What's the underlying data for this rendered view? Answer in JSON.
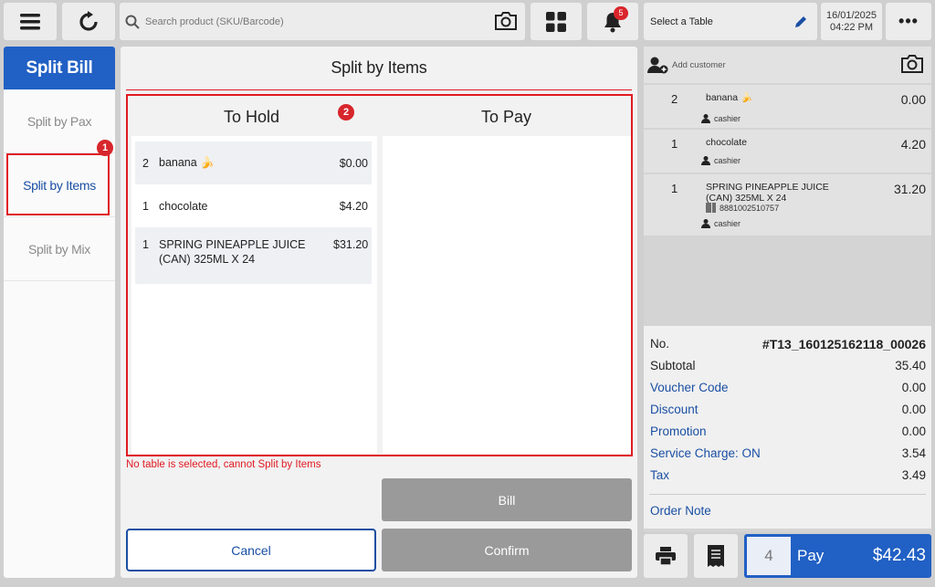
{
  "topbar": {
    "search_placeholder": "Search product (SKU/Barcode)",
    "notifications_count": "5",
    "table_label": "Select a Table",
    "date": "16/01/2025",
    "time": "04:22 PM",
    "more_label": "•••"
  },
  "sidebar": {
    "title": "Split Bill",
    "items": [
      {
        "label": "Split by Pax"
      },
      {
        "label": "Split by Items"
      },
      {
        "label": "Split by Mix"
      }
    ],
    "marker": "1"
  },
  "main": {
    "title": "Split by Items",
    "marker": "2",
    "to_hold_header": "To Hold",
    "to_pay_header": "To Pay",
    "to_hold_items": [
      {
        "qty": "2",
        "name": "banana 🍌",
        "price": "$0.00"
      },
      {
        "qty": "1",
        "name": "chocolate",
        "price": "$4.20"
      },
      {
        "qty": "1",
        "name": "SPRING PINEAPPLE JUICE (CAN) 325ML X 24",
        "price": "$31.20"
      }
    ],
    "error_message": "No table is selected, cannot Split by Items",
    "bill_label": "Bill",
    "cancel_label": "Cancel",
    "confirm_label": "Confirm"
  },
  "cart": {
    "add_customer_label": "Add customer",
    "items": [
      {
        "qty": "2",
        "name": "banana 🍌",
        "price": "0.00",
        "staff": "cashier"
      },
      {
        "qty": "1",
        "name": "chocolate",
        "price": "4.20",
        "staff": "cashier"
      },
      {
        "qty": "1",
        "name": "SPRING PINEAPPLE JUICE (CAN) 325ML X 24",
        "price": "31.20",
        "sku": "8881002510757",
        "staff": "cashier"
      }
    ]
  },
  "summary": {
    "no_label": "No.",
    "no_value": "#T13_160125162118_00026",
    "subtotal_label": "Subtotal",
    "subtotal_value": "35.40",
    "voucher_label": "Voucher Code",
    "voucher_value": "0.00",
    "discount_label": "Discount",
    "discount_value": "0.00",
    "promotion_label": "Promotion",
    "promotion_value": "0.00",
    "service_label": "Service Charge: ON",
    "service_value": "3.54",
    "tax_label": "Tax",
    "tax_value": "3.49",
    "order_note_label": "Order Note"
  },
  "pay": {
    "count": "4",
    "label": "Pay",
    "total": "$42.43"
  },
  "colors": {
    "brand_blue": "#2160c4",
    "alert_red": "#e01a22",
    "disabled_gray": "#9a9a9a"
  }
}
